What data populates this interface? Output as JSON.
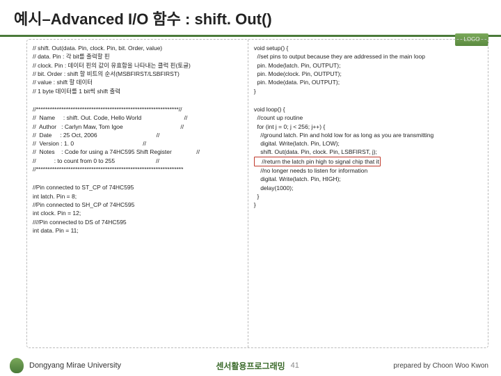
{
  "title": "예시–Advanced I/O 함수 : shift. Out()",
  "logo": "LOGO",
  "left": {
    "block1": "// shift. Out(data. Pin, clock. Pin, bit. Order, value)\n// data. Pin : 각 bit를 출력할 핀\n// clock. Pin : 데이터 핀의 값이 유효함을 나타내는 클럭 핀(토글)\n// bit. Order : shift 할 비트의 순서(MSBFIRST/LSBFIRST)\n// value : shift 할 데이터\n// 1 byte 데이터를 1 bit씩 shift 출력",
    "block2": "//**************************************************************//\n//  Name     : shift. Out. Code, Hello World                          //\n//  Author   : Carlyn Maw, Tom Igoe                                   //\n//  Date     : 25 Oct, 2006                                    //\n//  Version : 1. 0                                          //\n//  Notes    : Code for using a 74HC595 Shift Register               //\n//           : to count from 0 to 255                         //\n//****************************************************************",
    "block3": "//Pin connected to ST_CP of 74HC595\nint latch. Pin = 8;\n//Pin connected to SH_CP of 74HC595\nint clock. Pin = 12;\n////Pin connected to DS of 74HC595\nint data. Pin = 11;"
  },
  "right": {
    "block1": "void setup() {\n  //set pins to output because they are addressed in the main loop\n  pin. Mode(latch. Pin, OUTPUT);\n  pin. Mode(clock. Pin, OUTPUT);\n  pin. Mode(data. Pin, OUTPUT);\n}",
    "block2a": "void loop() {\n  //count up routine\n  for (int j = 0; j < 256; j++) {\n    //ground latch. Pin and hold low for as long as you are transmitting\n    digital. Write(latch. Pin, LOW);\n    shift. Out(data. Pin, clock. Pin, LSBFIRST, j);",
    "highlight": "    //return the latch pin high to signal chip that it",
    "block2b": "    //no longer needs to listen for information\n    digital. Write(latch. Pin, HIGH);\n    delay(1000);\n  }\n}"
  },
  "footer": {
    "university": "Dongyang Mirae University",
    "center": "센서활용프로그래밍",
    "page": "41",
    "right": "prepared by Choon Woo Kwon"
  }
}
